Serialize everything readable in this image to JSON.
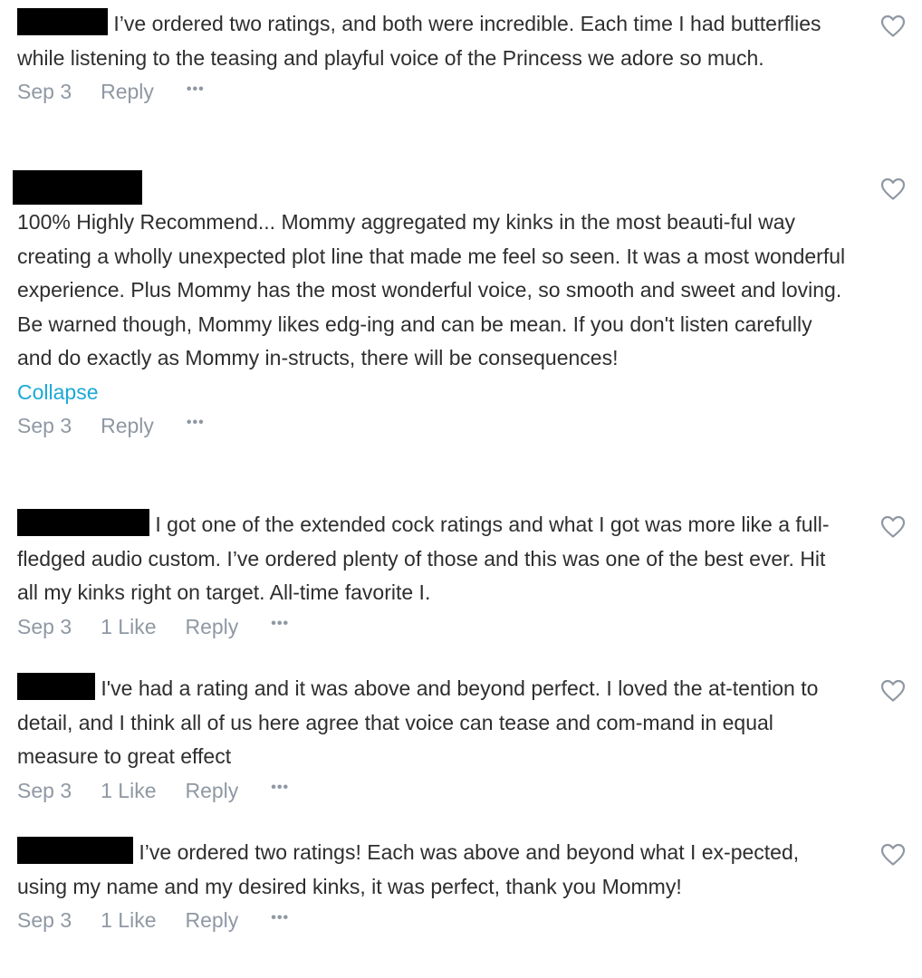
{
  "comments": [
    {
      "text": " I’ve ordered two ratings, and both were incredible. Each time I had butterflies while listening to the teasing and playful voice of the Princess we adore so much.",
      "date": "Sep 3",
      "likes": "",
      "reply": "Reply",
      "more": "•••"
    },
    {
      "text": "100% Highly Recommend... Mommy aggregated my kinks in the most beauti-ful way creating a wholly unexpected plot line that made me feel so seen. It was a most wonderful experience. Plus Mommy has the most wonderful voice, so smooth and sweet and loving. Be warned though, Mommy likes edg-ing and can be mean. If you don't listen carefully and do exactly as Mommy in-structs, there will be consequences!",
      "collapse": "Collapse",
      "date": "Sep 3",
      "likes": "",
      "reply": "Reply",
      "more": "•••"
    },
    {
      "text": " I got one of the extended cock ratings and what I got was more like a full-fledged audio custom. I’ve ordered plenty of those and this was one of the best ever. Hit all my kinks right on target. All-time favorite I.",
      "date": "Sep 3",
      "likes": "1 Like",
      "reply": "Reply",
      "more": "•••"
    },
    {
      "text": " I've had a rating and it was above and beyond perfect. I loved the at-tention to detail, and I think all of us here agree that voice can tease and com-mand in equal measure to great effect",
      "date": "Sep 3",
      "likes": "1 Like",
      "reply": "Reply",
      "more": "•••"
    },
    {
      "text": " I’ve ordered two ratings! Each was above and beyond what I ex-pected, using my name and my desired kinks, it was perfect, thank you Mommy!",
      "date": "Sep 3",
      "likes": "1 Like",
      "reply": "Reply",
      "more": "•••"
    }
  ],
  "icons": {
    "heart": "heart-outline-icon"
  },
  "colors": {
    "text": "#2e2e2e",
    "meta": "#8f98a3",
    "link": "#1ba9d6",
    "redaction": "#000000"
  }
}
